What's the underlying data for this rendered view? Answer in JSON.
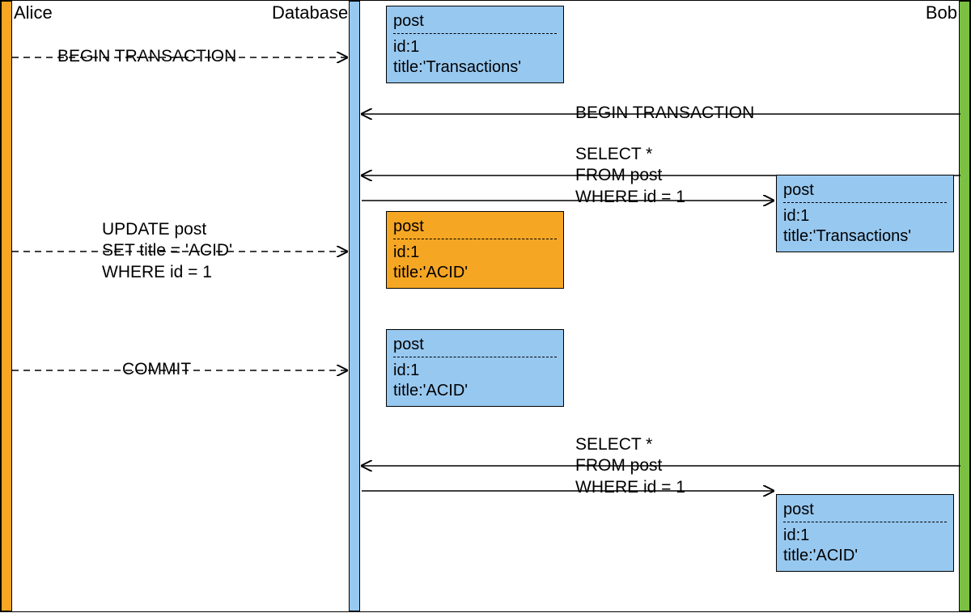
{
  "actors": {
    "alice": "Alice",
    "database": "Database",
    "bob": "Bob"
  },
  "messages": {
    "alice_begin": "BEGIN TRANSACTION",
    "alice_update": "UPDATE post\nSET title = 'ACID'\nWHERE id = 1",
    "alice_commit": "COMMIT",
    "bob_begin": "BEGIN TRANSACTION",
    "bob_select1": "SELECT *\nFROM post\nWHERE id = 1",
    "bob_select2": "SELECT *\nFROM post\nWHERE id = 1"
  },
  "states": {
    "db1": {
      "header": "post",
      "id": "id:1",
      "title": "title:'Transactions'"
    },
    "db2": {
      "header": "post",
      "id": "id:1",
      "title": "title:'ACID'"
    },
    "db3": {
      "header": "post",
      "id": "id:1",
      "title": "title:'ACID'"
    },
    "bob1": {
      "header": "post",
      "id": "id:1",
      "title": "title:'Transactions'"
    },
    "bob2": {
      "header": "post",
      "id": "id:1",
      "title": "title:'ACID'"
    }
  }
}
